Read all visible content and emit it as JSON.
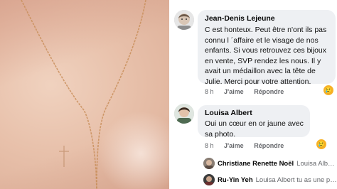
{
  "comments": [
    {
      "author": "Jean-Denis Lejeune",
      "text": "C est honteux. Peut être n'ont ils pas connu l ´affaire et le visage de nos enfants. Si vous retrouvez ces bijoux en vente, SVP rendez les nous. Il y avait un médaillon avec la tête de Julie. Merci pour votre attention.",
      "time": "8 h",
      "like_label": "J'aime",
      "reply_label": "Répondre",
      "reaction": "sad"
    },
    {
      "author": "Louisa Albert",
      "text": "Oui un cœur en or jaune avec sa photo.",
      "time": "8 h",
      "like_label": "J'aime",
      "reply_label": "Répondre",
      "reaction": "sad"
    }
  ],
  "replies": [
    {
      "author": "Christiane Renette Noël",
      "snippet": "Louisa Alber..."
    },
    {
      "author": "Ru-Yin Yeh",
      "snippet": "Louisa Albert tu as une pho..."
    }
  ],
  "icons": {
    "reaction_emoji": "😢"
  }
}
